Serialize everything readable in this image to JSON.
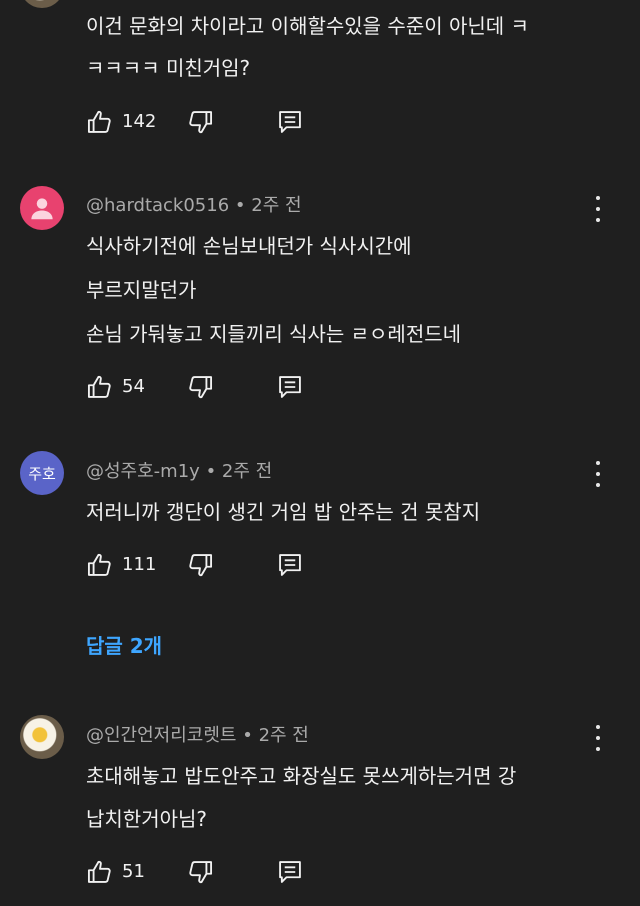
{
  "comments": [
    {
      "author": "",
      "time": "",
      "lines": [
        "이건 문화의 차이라고 이해할수있을 수준이 아닌데 ㅋ",
        "ㅋㅋㅋㅋ 미친거임?"
      ],
      "likes": "142",
      "avatar": "photo-partial"
    },
    {
      "author": "@hardtack0516",
      "time": "2주 전",
      "lines": [
        "식사하기전에 손님보내던가 식사시간에",
        "부르지말던가",
        "손님 가둬놓고 지들끼리 식사는 ㄹㅇ레전드네"
      ],
      "likes": "54",
      "avatar": "person-icon",
      "avatar_color": "#e8426f"
    },
    {
      "author": "@성주호-m1y",
      "time": "2주 전",
      "lines": [
        "저러니까 갱단이 생긴 거임 밥 안주는 건 못참지"
      ],
      "likes": "111",
      "avatar_text": "주호",
      "avatar_color": "#5a64c8",
      "replies_label": "답글 2개"
    },
    {
      "author": "@인간언저리코렛트",
      "time": "2주 전",
      "lines": [
        "초대해놓고 밥도안주고 화장실도 못쓰게하는거면 강",
        "납치한거아님?"
      ],
      "likes": "51",
      "avatar": "egg-photo"
    }
  ],
  "separator": "•",
  "icons": {
    "like": "thumbs-up-icon",
    "dislike": "thumbs-down-icon",
    "reply": "reply-icon",
    "more": "more-vert-icon"
  }
}
